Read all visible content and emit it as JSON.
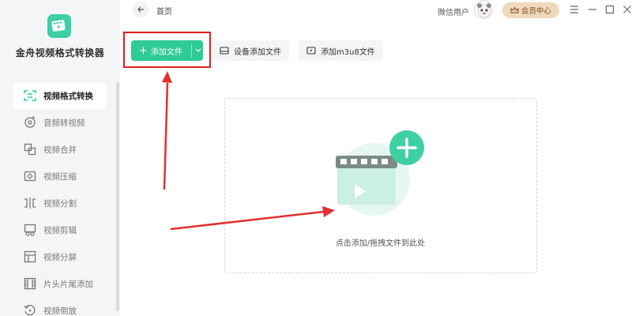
{
  "app": {
    "name": "金舟视频格式转换器"
  },
  "sidebar": {
    "items": [
      {
        "label": "视频格式转换",
        "icon": "format-convert-icon",
        "active": true
      },
      {
        "label": "音频转视频",
        "icon": "audio-disc-icon",
        "active": false
      },
      {
        "label": "视频合并",
        "icon": "merge-icon",
        "active": false
      },
      {
        "label": "视频压缩",
        "icon": "compress-icon",
        "active": false
      },
      {
        "label": "视频分割",
        "icon": "split-icon",
        "active": false
      },
      {
        "label": "视频剪辑",
        "icon": "scissors-icon",
        "active": false
      },
      {
        "label": "视频分屏",
        "icon": "split-screen-icon",
        "active": false
      },
      {
        "label": "片头片尾添加",
        "icon": "film-strip-icon",
        "active": false
      },
      {
        "label": "视频倒放",
        "icon": "reverse-icon",
        "active": false
      }
    ]
  },
  "header": {
    "breadcrumb": "首页",
    "user_name": "微信用户",
    "vip_label": "会员中心"
  },
  "toolbar": {
    "add_file_label": "添加文件",
    "device_add_label": "设备添加文件",
    "m3u8_add_label": "添加m3u8文件"
  },
  "drop_zone": {
    "hint": "点击添加/拖拽文件到此处"
  },
  "colors": {
    "accent": "#2ecb95",
    "highlight_box": "#e01f1f",
    "vip_bg": "#f0d8bd"
  }
}
